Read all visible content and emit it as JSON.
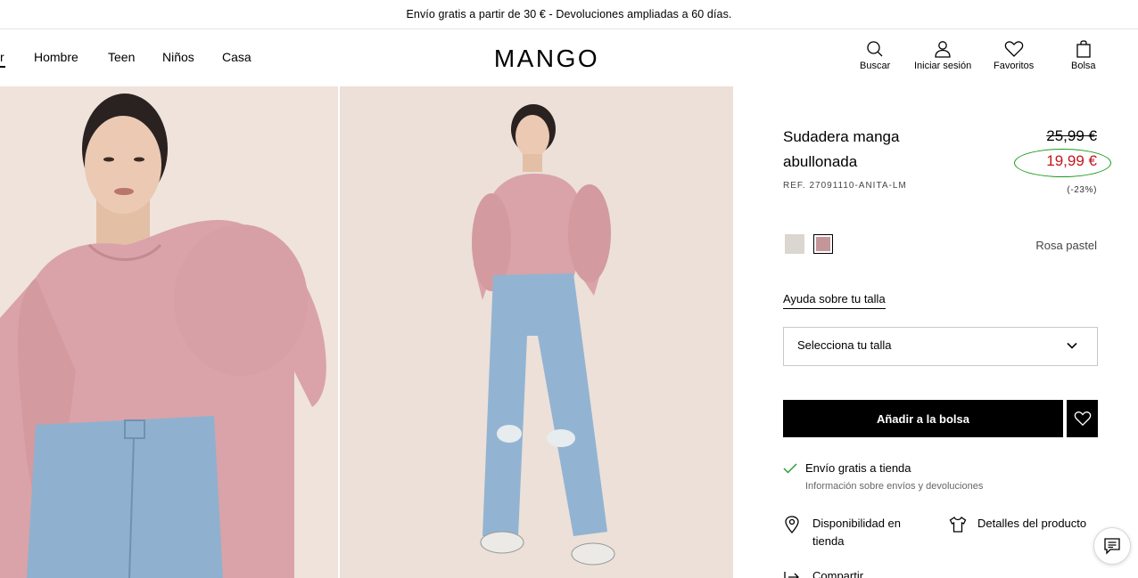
{
  "banner": {
    "text": "Envío gratis a partir de 30 € - Devoluciones ampliadas a 60 días."
  },
  "header": {
    "nav_cut": "r",
    "nav": [
      "Hombre",
      "Teen",
      "Niños",
      "Casa"
    ],
    "logo": "MANGO",
    "utilities": {
      "search": "Buscar",
      "login": "Iniciar sesión",
      "favorites": "Favoritos",
      "bag": "Bolsa"
    }
  },
  "product": {
    "title": "Sudadera manga abullonada",
    "ref": "REF. 27091110-ANITA-LM",
    "old_price": "25,99 €",
    "new_price": "19,99 €",
    "discount": "(-23%)",
    "color_name": "Rosa pastel",
    "size_help": "Ayuda sobre tu talla",
    "size_select": "Selecciona tu talla",
    "add_to_bag": "Añadir a la bolsa",
    "shipping": "Envío gratis a tienda",
    "shipping_info": "Información sobre envíos y devoluciones",
    "availability": "Disponibilidad en tienda",
    "details": "Detalles del producto",
    "share": "Compartir"
  },
  "colors": {
    "sale_red": "#c4161c",
    "highlight_green": "#1a9a1a",
    "swatch_beige": "#dcd6d0",
    "swatch_pink": "#c4969a"
  }
}
